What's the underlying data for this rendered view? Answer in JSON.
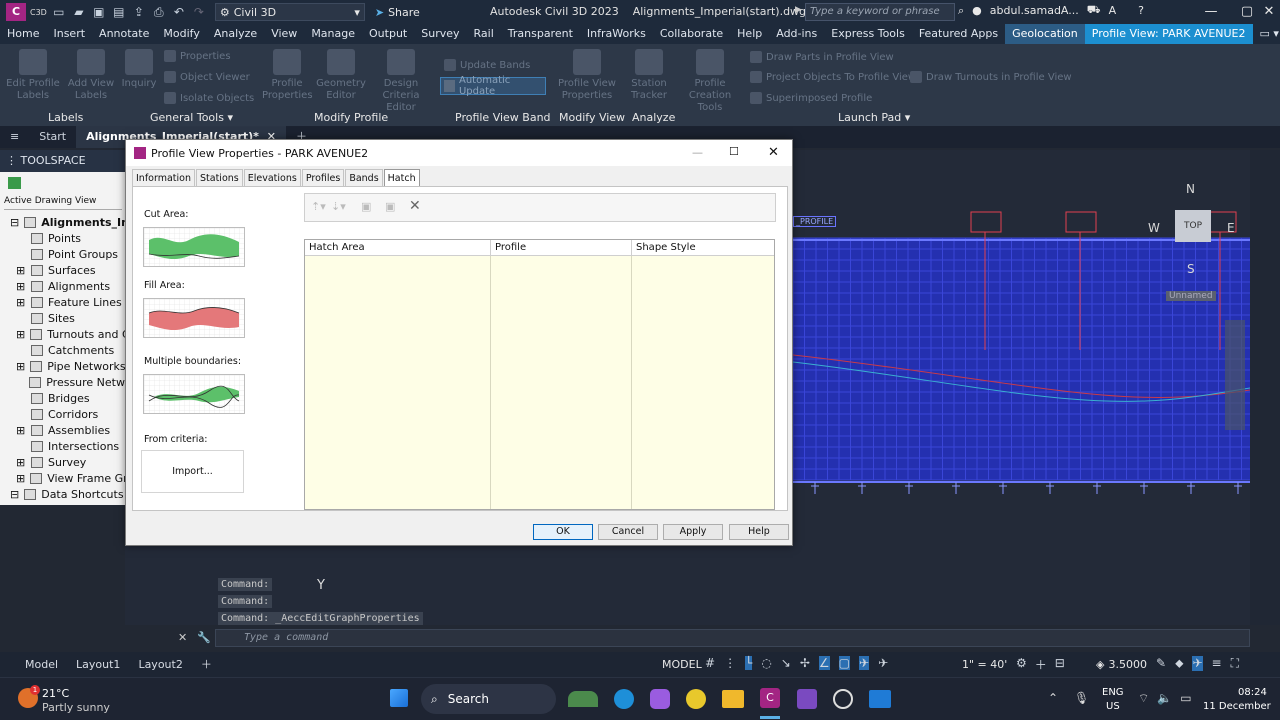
{
  "titlebar": {
    "app_badge": "C",
    "product_code": "C3D",
    "workspace": "Civil 3D",
    "share_label": "Share",
    "app_title": "Autodesk Civil 3D 2023",
    "file_title": "Alignments_Imperial(start).dwg",
    "search_placeholder": "Type a keyword or phrase",
    "user": "abdul.samadA..."
  },
  "menu_tabs": [
    "Home",
    "Insert",
    "Annotate",
    "Modify",
    "Analyze",
    "View",
    "Manage",
    "Output",
    "Survey",
    "Rail",
    "Transparent",
    "InfraWorks",
    "Collaborate",
    "Help",
    "Add-ins",
    "Express Tools",
    "Featured Apps",
    "Geolocation",
    "Profile View: PARK AVENUE2"
  ],
  "ribbon": {
    "buttons": {
      "edit_profile_labels": "Edit Profile Labels",
      "add_view_labels": "Add View Labels",
      "inquiry": "Inquiry",
      "properties": "Properties",
      "object_viewer": "Object Viewer",
      "isolate_objects": "Isolate Objects",
      "profile_properties": "Profile Properties",
      "geometry_editor": "Geometry Editor",
      "design_criteria_editor": "Design Criteria Editor",
      "update_bands": "Update Bands",
      "automatic_update": "Automatic Update",
      "profile_view_properties": "Profile View Properties",
      "station_tracker": "Station Tracker",
      "profile_creation_tools": "Profile Creation Tools",
      "draw_parts": "Draw Parts in Profile View",
      "project_objects": "Project Objects To Profile View",
      "draw_turnouts": "Draw Turnouts in Profile View",
      "superimposed_profile": "Superimposed Profile"
    },
    "panels": {
      "labels": "Labels",
      "general_tools": "General Tools",
      "modify_profile": "Modify Profile",
      "profile_view_band": "Profile View Band",
      "modify_view": "Modify View",
      "analyze": "Analyze",
      "launch_pad": "Launch Pad"
    }
  },
  "doc_tabs": {
    "start": "Start",
    "active": "Alignments_Imperial(start)*"
  },
  "toolspace": {
    "header": "TOOLSPACE",
    "view_selector": "Active Drawing View",
    "root": "Alignments_Imperi",
    "items": [
      "Points",
      "Point Groups",
      "Surfaces",
      "Alignments",
      "Feature Lines",
      "Sites",
      "Turnouts and C",
      "Catchments",
      "Pipe Networks",
      "Pressure Netw",
      "Bridges",
      "Corridors",
      "Assemblies",
      "Intersections",
      "Survey",
      "View Frame Gr"
    ],
    "data_shortcuts": "Data Shortcuts []"
  },
  "canvas": {
    "profile_tag": "_PROFILE",
    "viewcube_top": "TOP",
    "compass": {
      "n": "N",
      "e": "E",
      "s": "S",
      "w": "W"
    },
    "unnamed": "Unnamed"
  },
  "dialog": {
    "title": "Profile View Properties - PARK AVENUE2",
    "tabs": [
      "Information",
      "Stations",
      "Elevations",
      "Profiles",
      "Bands",
      "Hatch"
    ],
    "active_tab": "Hatch",
    "cut_area": "Cut Area:",
    "fill_area": "Fill Area:",
    "multiple_boundaries": "Multiple boundaries:",
    "from_criteria": "From criteria:",
    "import_button": "Import...",
    "columns": [
      "Hatch Area",
      "Profile",
      "Shape Style"
    ],
    "rows": [],
    "buttons": {
      "ok": "OK",
      "cancel": "Cancel",
      "apply": "Apply",
      "help": "Help"
    }
  },
  "command": {
    "history": [
      "Command:",
      "Command:",
      "Command:  _AeccEditGraphProperties"
    ],
    "placeholder": "Type a command",
    "axis_y": "Y"
  },
  "status": {
    "tabs": [
      "Model",
      "Layout1",
      "Layout2"
    ],
    "model_label": "MODEL",
    "scale": "1\" = 40'",
    "lineweight": "3.5000"
  },
  "taskbar": {
    "weather_temp": "21°C",
    "weather_desc": "Partly sunny",
    "weather_badge": "1",
    "search": "Search",
    "lang1": "ENG",
    "lang2": "US",
    "time": "08:24",
    "date": "11 December"
  },
  "colors": {
    "cut_fill": "#5cc06a",
    "fill_fill": "#e4787a",
    "accent": "#1c8fd0",
    "grid": "#3a46d8"
  }
}
